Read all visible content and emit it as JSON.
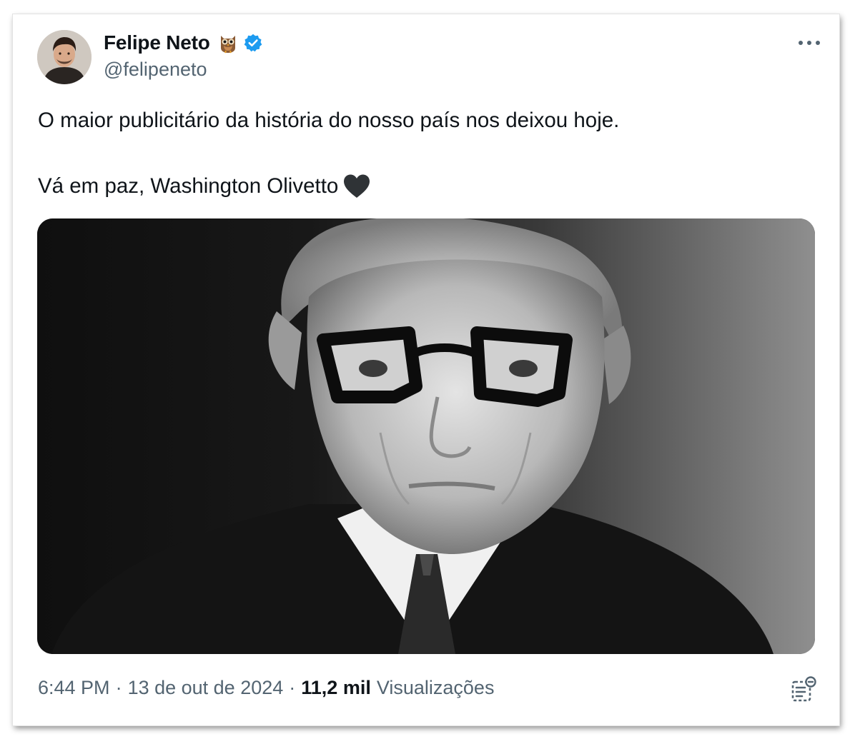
{
  "author": {
    "display_name": "Felipe Neto",
    "handle": "@felipeneto",
    "verified": true
  },
  "tweet": {
    "line1": "O maior publicitário da história do nosso país nos deixou hoje.",
    "line2": "Vá em paz, Washington Olivetto"
  },
  "meta": {
    "time": "6:44 PM",
    "separator": "·",
    "date": "13 de out de 2024",
    "views_count": "11,2 mil",
    "views_label": "Visualizações"
  },
  "icons": {
    "owl": "owl-emoji-icon",
    "verified": "verified-badge-icon",
    "more": "more-dots-icon",
    "heart": "black-heart-icon",
    "stats": "post-analytics-icon"
  },
  "colors": {
    "text": "#0f1419",
    "secondary": "#536471",
    "verified": "#1d9bf0"
  }
}
